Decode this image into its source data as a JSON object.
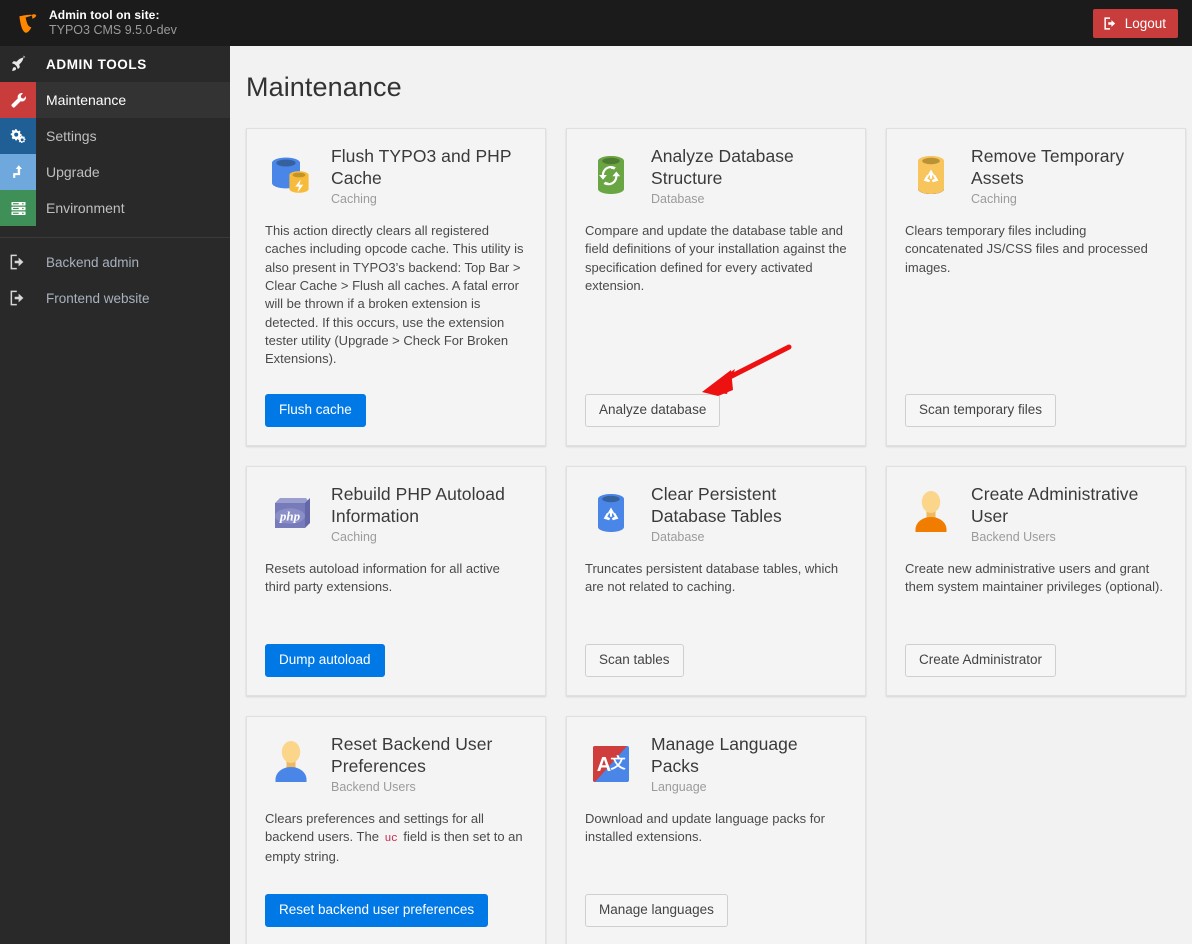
{
  "topbar": {
    "logo_icon": "typo3-logo-icon",
    "title_line1": "Admin tool on site:",
    "title_line2": "TYPO3 CMS 9.5.0-dev",
    "logout_label": "Logout",
    "logout_icon": "logout-icon",
    "logout_color": "#c83c3c"
  },
  "sidebar": {
    "bg_color": "#292929",
    "header": {
      "label": "ADMIN TOOLS",
      "icon": "rocket-icon"
    },
    "items": [
      {
        "label": "Maintenance",
        "icon": "wrench-icon",
        "tile_color": "#c83c3c",
        "active": true
      },
      {
        "label": "Settings",
        "icon": "gears-icon",
        "tile_color": "#1f5f96",
        "active": false
      },
      {
        "label": "Upgrade",
        "icon": "upgrade-arrow-icon",
        "tile_color": "#6ea8dc",
        "active": false
      },
      {
        "label": "Environment",
        "icon": "server-icon",
        "tile_color": "#3f9058",
        "active": false
      }
    ],
    "links": [
      {
        "label": "Backend admin",
        "icon": "exit-icon"
      },
      {
        "label": "Frontend website",
        "icon": "exit-icon"
      }
    ]
  },
  "main": {
    "page_title": "Maintenance",
    "cards": [
      {
        "title": "Flush TYPO3 and PHP Cache",
        "category": "Caching",
        "icon": "cache-database-bolt-icon",
        "description": "This action directly clears all registered caches including opcode cache. This utility is also present in TYPO3’s backend: Top Bar > Clear Cache > Flush all caches. A fatal error will be thrown if a broken extension is detected. If this occurs, use the extension tester utility (Upgrade > Check For Broken Extensions).",
        "button_label": "Flush cache",
        "button_style": "primary"
      },
      {
        "title": "Analyze Database Structure",
        "category": "Database",
        "icon": "database-sync-icon",
        "description": "Compare and update the database table and field definitions of your installation against the specification defined for every activated extension.",
        "button_label": "Analyze database",
        "button_style": "default"
      },
      {
        "title": "Remove Temporary Assets",
        "category": "Caching",
        "icon": "database-recycle-yellow-icon",
        "description": "Clears temporary files including concatenated JS/CSS files and processed images.",
        "button_label": "Scan temporary files",
        "button_style": "default"
      },
      {
        "title": "Rebuild PHP Autoload Information",
        "category": "Caching",
        "icon": "php-box-icon",
        "description": "Resets autoload information for all active third party extensions.",
        "button_label": "Dump autoload",
        "button_style": "primary"
      },
      {
        "title": "Clear Persistent Database Tables",
        "category": "Database",
        "icon": "database-recycle-blue-icon",
        "description": "Truncates persistent database tables, which are not related to caching.",
        "button_label": "Scan tables",
        "button_style": "default"
      },
      {
        "title": "Create Administrative User",
        "category": "Backend Users",
        "icon": "user-orange-icon",
        "description": "Create new administrative users and grant them system maintainer privileges (optional).",
        "button_label": "Create Administrator",
        "button_style": "default"
      },
      {
        "title": "Reset Backend User Preferences",
        "category": "Backend Users",
        "icon": "user-blue-icon",
        "description_pre": "Clears preferences and settings for all backend users. The ",
        "description_code": "uc",
        "description_post": " field is then set to an empty string.",
        "button_label": "Reset backend user preferences",
        "button_style": "primary"
      },
      {
        "title": "Manage Language Packs",
        "category": "Language",
        "icon": "language-translate-icon",
        "description": "Download and update language packs for installed extensions.",
        "button_label": "Manage languages",
        "button_style": "default"
      }
    ]
  },
  "annotation": {
    "type": "arrow",
    "color": "#ee1111",
    "points_to": "analyze-database-button"
  }
}
